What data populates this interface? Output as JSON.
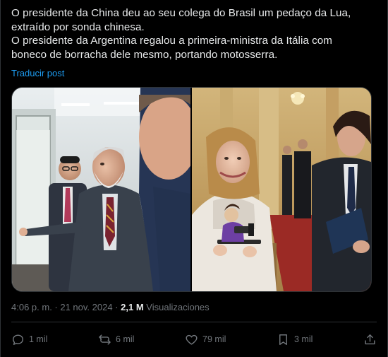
{
  "post": {
    "text_lines": [
      "O presidente da China deu ao seu colega do Brasil um pedaço da Lua,",
      "extraído por sonda chinesa.",
      "O presidente da Argentina regalou a primeira-ministra da Itália com",
      "boneco de borracha dele mesmo, portando motosserra."
    ],
    "translate_label": "Traducir post",
    "timestamp": "4:06 p. m. · 21 nov. 2024 ·",
    "views_count": "2,1 M",
    "views_label": "Visualizaciones"
  },
  "actions": {
    "replies": "1 mil",
    "reposts": "6 mil",
    "likes": "79 mil",
    "bookmarks": "3 mil"
  },
  "colors": {
    "background": "#000000",
    "text": "#e7e9ea",
    "secondary_text": "#71767b",
    "link": "#1d9bf0",
    "border": "#2f3336"
  }
}
